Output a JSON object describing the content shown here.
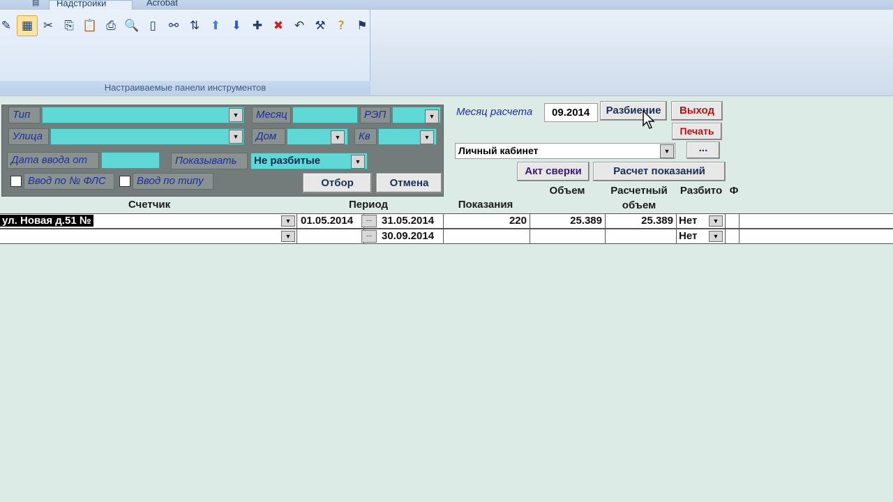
{
  "ribbon": {
    "tabs": [
      "Надстройки",
      "Acrobat"
    ],
    "group_label": "Настраиваемые панели инструментов",
    "toolbar_icons": [
      "edit-pencil-icon",
      "form-view-icon",
      "cut-icon",
      "copy-icon",
      "paste-icon",
      "print-icon",
      "print-preview-icon",
      "page-icon",
      "find-binoculars-icon",
      "sort-az-icon",
      "arrow-up-icon",
      "arrow-down-icon",
      "new-record-icon",
      "delete-record-icon",
      "undo-icon",
      "tools-icon",
      "help-icon",
      "run-icon"
    ]
  },
  "filter": {
    "type_label": "Тип",
    "type_value": "",
    "month_label": "Месяц",
    "month_value": "",
    "rep_label": "РЭП",
    "rep_value": "",
    "street_label": "Улица",
    "street_value": "",
    "house_label": "Дом",
    "house_value": "",
    "apt_label": "Кв",
    "apt_value": "",
    "date_from_label": "Дата ввода от",
    "date_from_value": "",
    "show_label": "Показывать",
    "show_value": "Не разбитые",
    "chk_fls_label": "Ввод по № ФЛС",
    "chk_type_label": "Ввод по типу",
    "apply_button": "Отбор",
    "cancel_button": "Отмена"
  },
  "right": {
    "calc_month_label": "Месяц расчета",
    "calc_month_value": "09.2014",
    "split_button": "Разбиение",
    "exit_button": "Выход",
    "print_button": "Печать",
    "cabinet_value": "Личный кабинет",
    "ellipsis_button": "...",
    "act_button": "Акт сверки",
    "calc_readings_button": "Расчет показаний"
  },
  "grid": {
    "headers": {
      "meter": "Счетчик",
      "period": "Период",
      "readings": "Показания",
      "volume": "Объем",
      "calc_volume_1": "Расчетный",
      "calc_volume_2": "объем",
      "split": "Разбито",
      "f": "Ф"
    },
    "rows": [
      {
        "meter": "ул. Новая д.51 №",
        "from": "01.05.2014",
        "to": "31.05.2014",
        "readings": "220",
        "volume": "25.389",
        "calc_volume": "25.389",
        "split": "Нет"
      },
      {
        "meter": "",
        "from": "",
        "to": "30.09.2014",
        "readings": "",
        "volume": "",
        "calc_volume": "",
        "split": "Нет"
      }
    ]
  },
  "colors": {
    "background": "#dcebe6",
    "field_cyan": "#60d9d6",
    "panel_gray": "#747c7b",
    "label_blue": "#1b2fa1",
    "exit_red": "#b01212"
  }
}
